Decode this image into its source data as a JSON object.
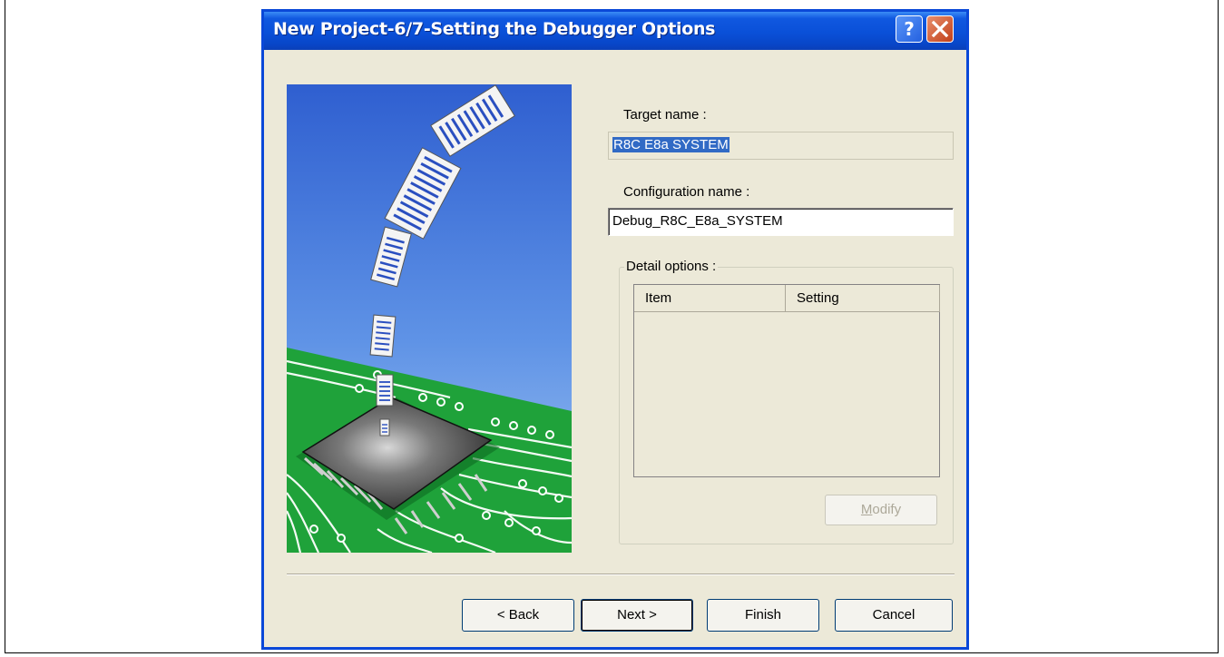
{
  "dialog": {
    "title": "New Project-6/7-Setting the Debugger Options",
    "help_glyph": "?",
    "close_icon": "close-icon",
    "help_icon": "help-icon"
  },
  "illustration": {
    "icon": "chip-documents-illustration",
    "colors": {
      "sky": "#3d6fd6",
      "board": "#1fa23a"
    }
  },
  "target": {
    "label": "Target name :",
    "value": "R8C E8a SYSTEM"
  },
  "configuration": {
    "label": "Configuration name :",
    "value": "Debug_R8C_E8a_SYSTEM"
  },
  "detail": {
    "legend": "Detail options :",
    "columns": [
      "Item",
      "Setting"
    ],
    "modify_label": "Modify",
    "modify_mnemonic": "M"
  },
  "buttons": {
    "back": "< Back",
    "next": "Next >",
    "finish": "Finish",
    "cancel": "Cancel"
  }
}
